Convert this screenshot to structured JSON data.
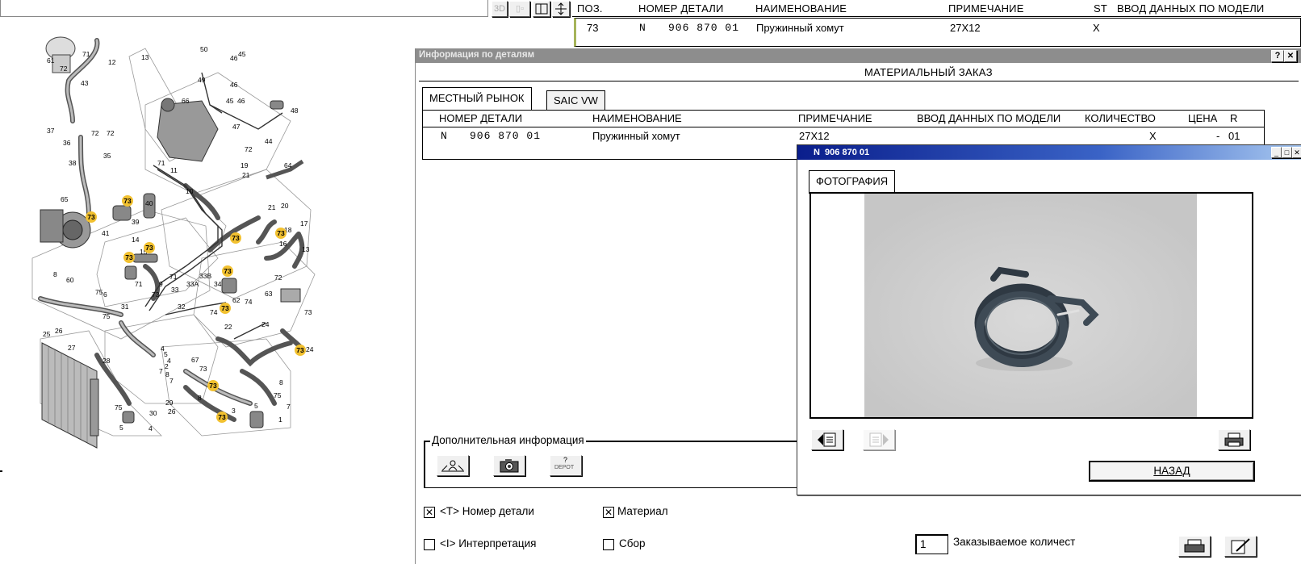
{
  "top_toolbar": {
    "btn_3d": "3D"
  },
  "top_table": {
    "columns": [
      "ПОЗ.",
      "НОМЕР ДЕТАЛИ",
      "НАИМЕНОВАНИЕ",
      "ПРИМЕЧАНИЕ",
      "ST",
      "ВВОД ДАННЫХ ПО МОДЕЛИ"
    ],
    "row": {
      "pos": "73",
      "prefix": "N",
      "part_number": "906 870 01",
      "name": "Пружинный хомут",
      "note": "27X12",
      "st": "X"
    }
  },
  "diagram": {
    "labels": [
      "61",
      "71",
      "12",
      "13",
      "72",
      "43",
      "37",
      "36",
      "35",
      "72",
      "72",
      "38",
      "40",
      "39",
      "41",
      "65",
      "73",
      "50",
      "49",
      "46",
      "45",
      "46",
      "45",
      "46",
      "47",
      "44",
      "66",
      "48",
      "72",
      "71",
      "11",
      "10",
      "19",
      "21",
      "64",
      "21",
      "20",
      "17",
      "18",
      "16",
      "73",
      "14",
      "15",
      "73",
      "73",
      "71",
      "9",
      "71",
      "13",
      "72",
      "63",
      "33B",
      "33A",
      "34",
      "62",
      "74",
      "74",
      "75",
      "6",
      "75",
      "31",
      "32",
      "33",
      "73",
      "23",
      "24",
      "22",
      "24",
      "73",
      "7",
      "8",
      "60",
      "25",
      "26",
      "27",
      "28",
      "29",
      "30",
      "26",
      "4",
      "5",
      "67",
      "8",
      "73",
      "73",
      "5",
      "3",
      "1",
      "7",
      "8",
      "5",
      "75",
      "7",
      "4",
      "4",
      "7",
      "8",
      "2",
      "75",
      "5"
    ],
    "callout_number": "73"
  },
  "details_window": {
    "title": "Информация по деталям",
    "help_btn": "?",
    "close_btn": "✕",
    "section_title": "МАТЕРИАЛЬНЫЙ ЗАКАЗ",
    "tabs": [
      "МЕСТНЫЙ РЫНОК",
      "SAIC VW"
    ],
    "columns": [
      "НОМЕР ДЕТАЛИ",
      "НАИМЕНОВАНИЕ",
      "ПРИМЕЧАНИЕ",
      "ВВОД ДАННЫХ ПО МОДЕЛИ",
      "КОЛИЧЕСТВО",
      "ЦЕНА",
      "R"
    ],
    "row": {
      "prefix": "N",
      "part_number": "906 870 01",
      "name": "Пружинный хомут",
      "note": "27X12",
      "quantity": "X",
      "price": "-",
      "r": "01"
    },
    "additional_info_label": "Дополнительная информация",
    "depot_label": "DEPOT",
    "depot_q": "?",
    "checkboxes": {
      "part_number_label": "<T> Номер детали",
      "part_number_checked": true,
      "material_label": "Материал",
      "material_checked": true,
      "interpretation_label": "<I> Интерпретация",
      "interpretation_checked": false,
      "assembly_label": "Сбор",
      "assembly_checked": false
    },
    "order_qty_value": "1",
    "order_qty_label": "Заказываемое количест"
  },
  "photo_window": {
    "title": "N  906 870 01",
    "tab": "ФОТОГРАФИЯ",
    "back_button": "НАЗАД",
    "colors": {
      "titlebar_start": "#0a1e8c",
      "titlebar_end": "#a8c8f0",
      "photo_bg": "#cfcfcf"
    }
  }
}
